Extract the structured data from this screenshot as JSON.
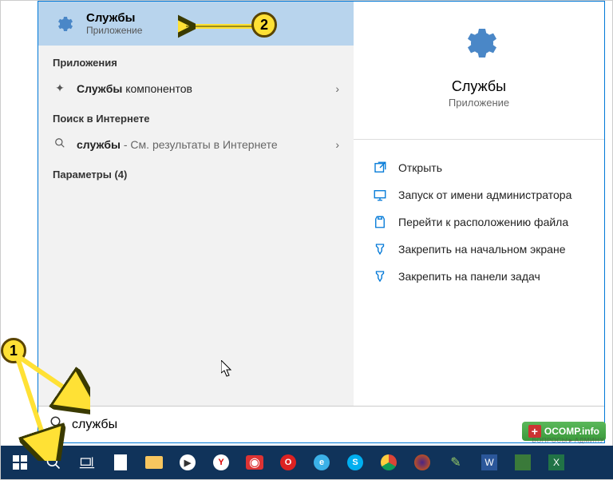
{
  "bestMatch": {
    "title": "Службы",
    "subtitle": "Приложение"
  },
  "sections": {
    "apps": "Приложения",
    "web": "Поиск в Интернете",
    "params": "Параметры (4)"
  },
  "results": {
    "appRow": {
      "strong": "Службы",
      "rest": " компонентов"
    },
    "webRow": {
      "strong": "службы",
      "rest": " - См. результаты в Интернете"
    }
  },
  "detail": {
    "title": "Службы",
    "subtitle": "Приложение",
    "actions": [
      "Открыть",
      "Запуск от имени администратора",
      "Перейти к расположению файла",
      "Закрепить на начальном экране",
      "Закрепить на панели задач"
    ]
  },
  "search": {
    "query": "службы"
  },
  "callouts": {
    "one": "1",
    "two": "2"
  },
  "watermark": {
    "main": "OCOMP.info",
    "sub": "ВОПРОСЫ►АДМИНУ"
  }
}
